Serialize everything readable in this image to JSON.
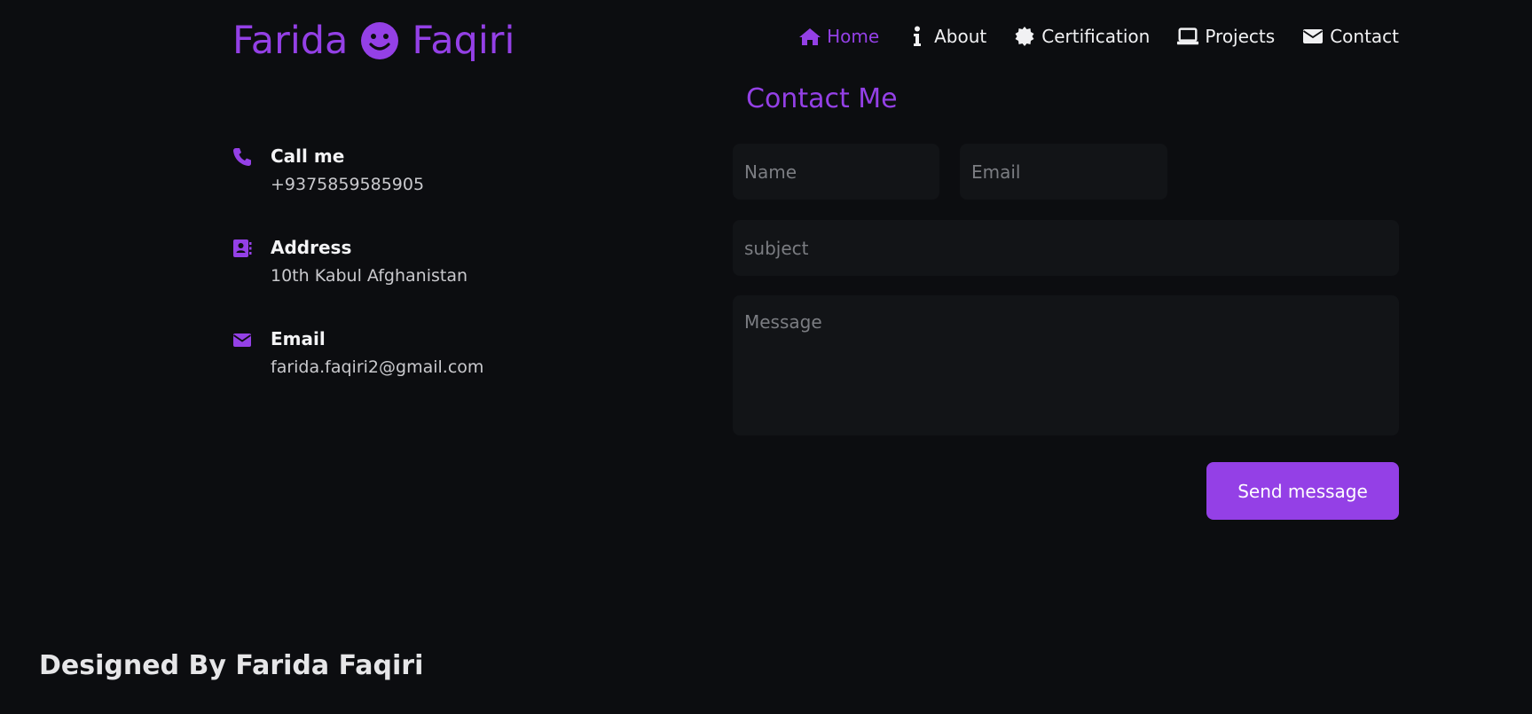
{
  "header": {
    "logo_first": "Farida",
    "logo_last": "Faqiri",
    "logo_icon": "smiley-icon",
    "nav": [
      {
        "label": "Home",
        "icon": "home-icon",
        "active": true
      },
      {
        "label": "About",
        "icon": "info-icon",
        "active": false
      },
      {
        "label": "Certification",
        "icon": "certificate-icon",
        "active": false
      },
      {
        "label": "Projects",
        "icon": "laptop-icon",
        "active": false
      },
      {
        "label": "Contact",
        "icon": "envelope-icon",
        "active": false
      }
    ]
  },
  "contact": {
    "title": "Contact Me",
    "info": [
      {
        "label": "Call me",
        "value": "+9375859585905",
        "icon": "phone-icon"
      },
      {
        "label": "Address",
        "value": "10th Kabul Afghanistan",
        "icon": "address-book-icon"
      },
      {
        "label": "Email",
        "value": "farida.faqiri2@gmail.com",
        "icon": "envelope-icon"
      }
    ]
  },
  "form": {
    "name_placeholder": "Name",
    "email_placeholder": "Email",
    "subject_placeholder": "subject",
    "message_placeholder": "Message",
    "send_label": "Send message"
  },
  "footer": {
    "text": "Designed By Farida Faqiri"
  },
  "colors": {
    "accent": "#9440e6",
    "background": "#0c0d10",
    "field_background": "#121417"
  }
}
